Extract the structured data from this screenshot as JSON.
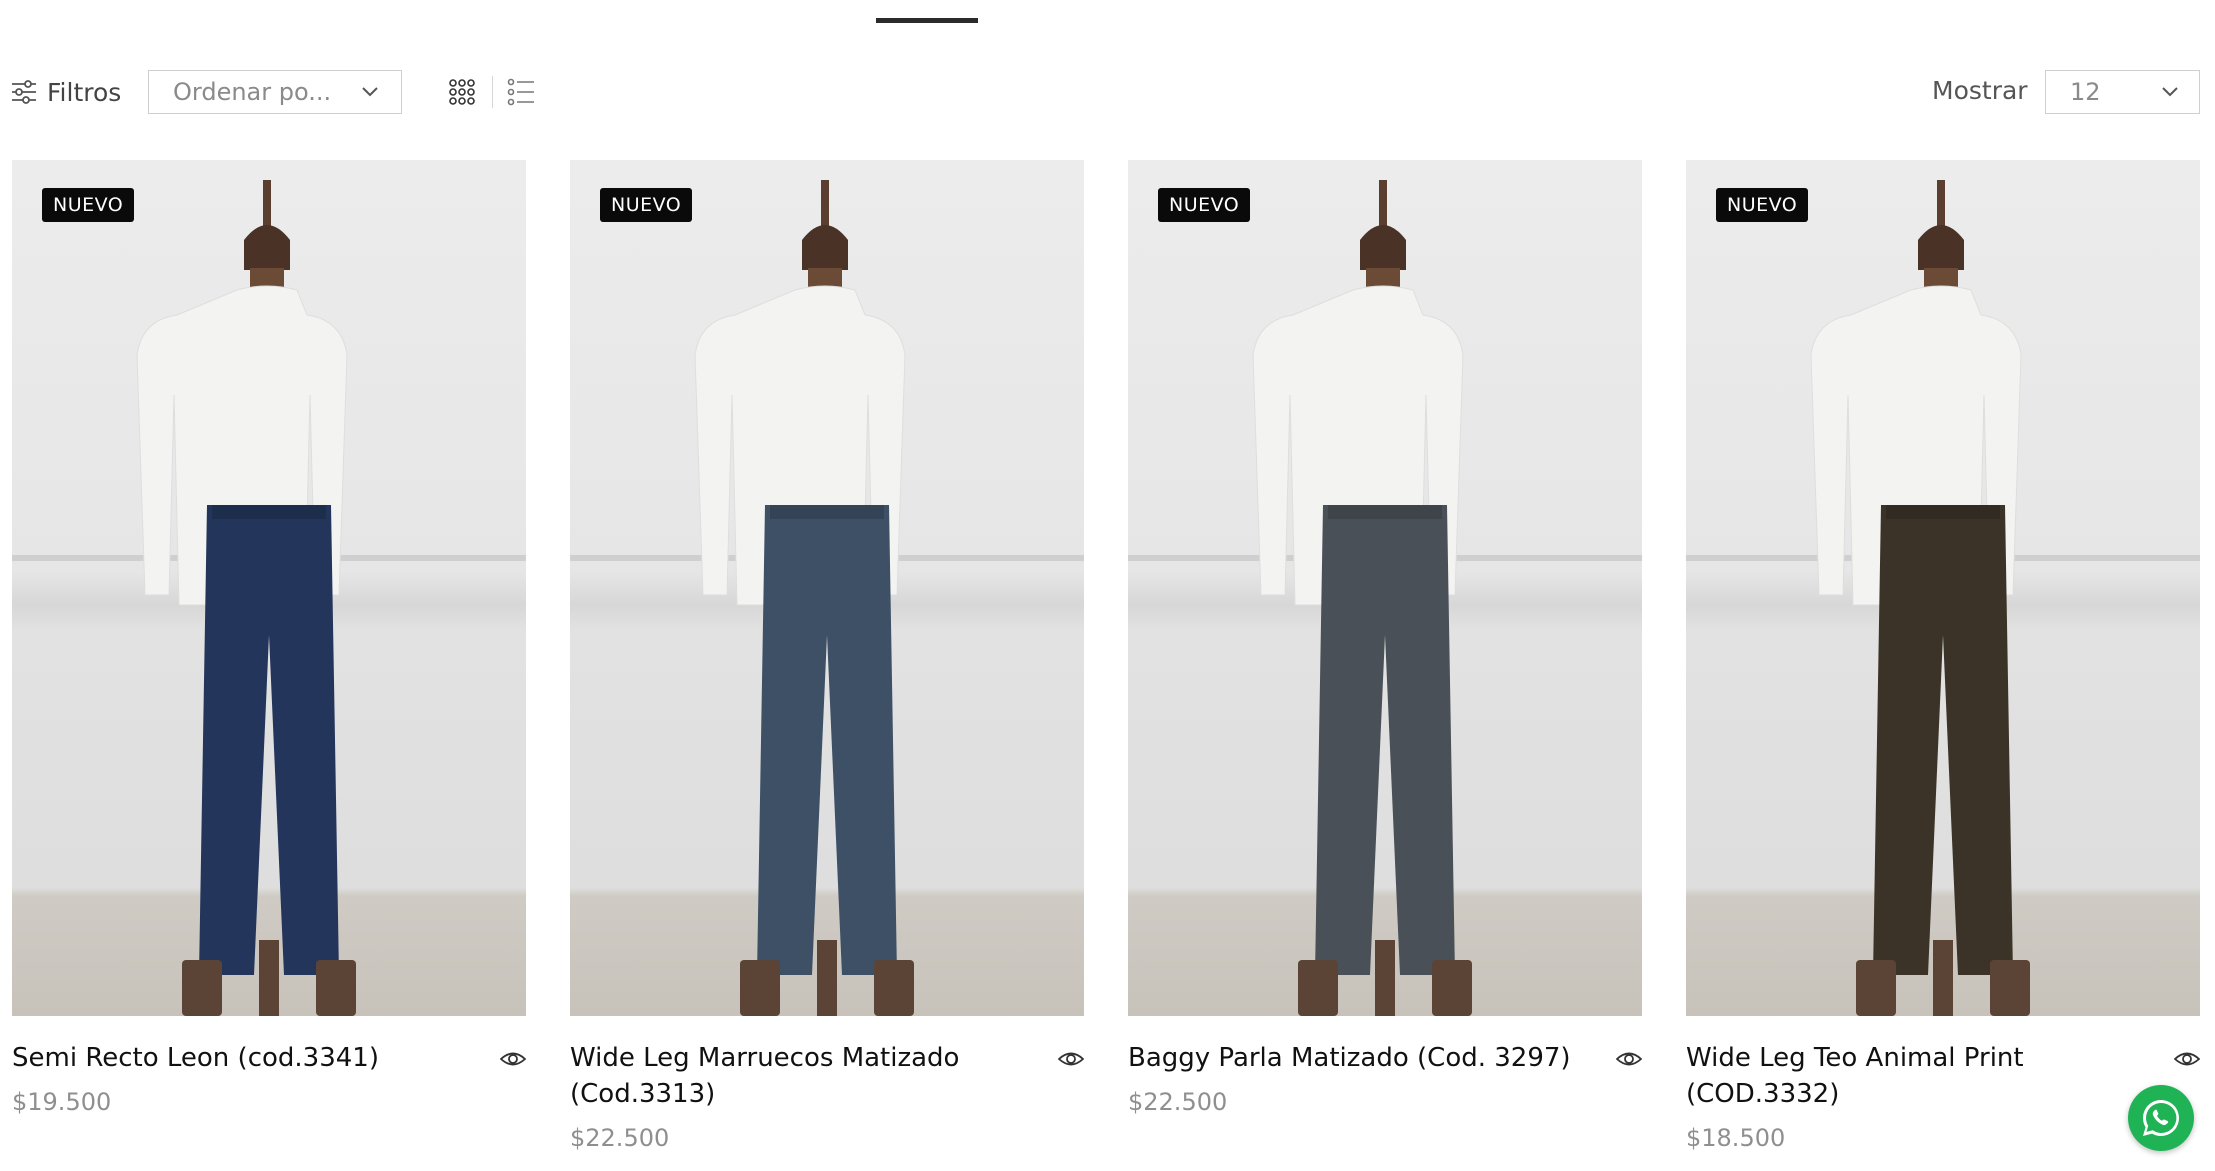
{
  "toolbar": {
    "filters_label": "Filtros",
    "sort_value": "Ordenar po...",
    "show_label": "Mostrar",
    "show_value": "12"
  },
  "products": [
    {
      "badge": "NUEVO",
      "title": "Semi Recto Leon (cod.3341)",
      "price": "$19.500",
      "jeans_color": "#23355a"
    },
    {
      "badge": "NUEVO",
      "title": "Wide Leg Marruecos Matizado (Cod.3313)",
      "price": "$22.500",
      "jeans_color": "#3e5066"
    },
    {
      "badge": "NUEVO",
      "title": "Baggy Parla Matizado (Cod. 3297)",
      "price": "$22.500",
      "jeans_color": "#4a5058"
    },
    {
      "badge": "NUEVO",
      "title": "Wide Leg Teo Animal Print (COD.3332)",
      "price": "$18.500",
      "jeans_color": "#3b3327"
    }
  ],
  "colors": {
    "badge_bg": "#0a0a0a",
    "whatsapp": "#1fb355",
    "price": "#8f8f8f"
  }
}
